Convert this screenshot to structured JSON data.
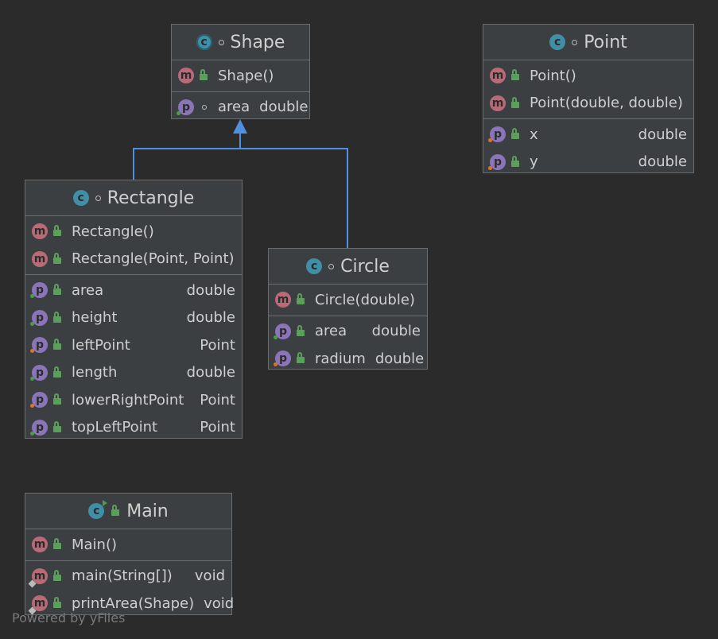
{
  "footer": "Powered by yFiles",
  "classes": {
    "shape": {
      "name": "Shape",
      "constructor": "Shape()",
      "fields": [
        {
          "name": "area",
          "type": "double"
        }
      ]
    },
    "point": {
      "name": "Point",
      "methods": [
        "Point()",
        "Point(double, double)"
      ],
      "fields": [
        {
          "name": "x",
          "type": "double"
        },
        {
          "name": "y",
          "type": "double"
        }
      ]
    },
    "rectangle": {
      "name": "Rectangle",
      "methods": [
        "Rectangle()",
        "Rectangle(Point, Point)"
      ],
      "fields": [
        {
          "name": "area",
          "type": "double"
        },
        {
          "name": "height",
          "type": "double"
        },
        {
          "name": "leftPoint",
          "type": "Point"
        },
        {
          "name": "length",
          "type": "double"
        },
        {
          "name": "lowerRightPoint",
          "type": "Point"
        },
        {
          "name": "topLeftPoint",
          "type": "Point"
        }
      ]
    },
    "circle": {
      "name": "Circle",
      "methods": [
        "Circle(double)"
      ],
      "fields": [
        {
          "name": "area",
          "type": "double"
        },
        {
          "name": "radium",
          "type": "double"
        }
      ]
    },
    "main": {
      "name": "Main",
      "methods": [
        {
          "name": "Main()",
          "type": ""
        }
      ],
      "static_methods": [
        {
          "name": "main(String[])",
          "type": "void"
        },
        {
          "name": "printArea(Shape)",
          "type": "void"
        }
      ]
    }
  },
  "colors": {
    "background": "#2b2b2b",
    "node_fill": "#3c3f41",
    "inheritance_edge": "#4f8fe0"
  },
  "icons": {
    "method": "m",
    "property": "p",
    "class": "c"
  }
}
